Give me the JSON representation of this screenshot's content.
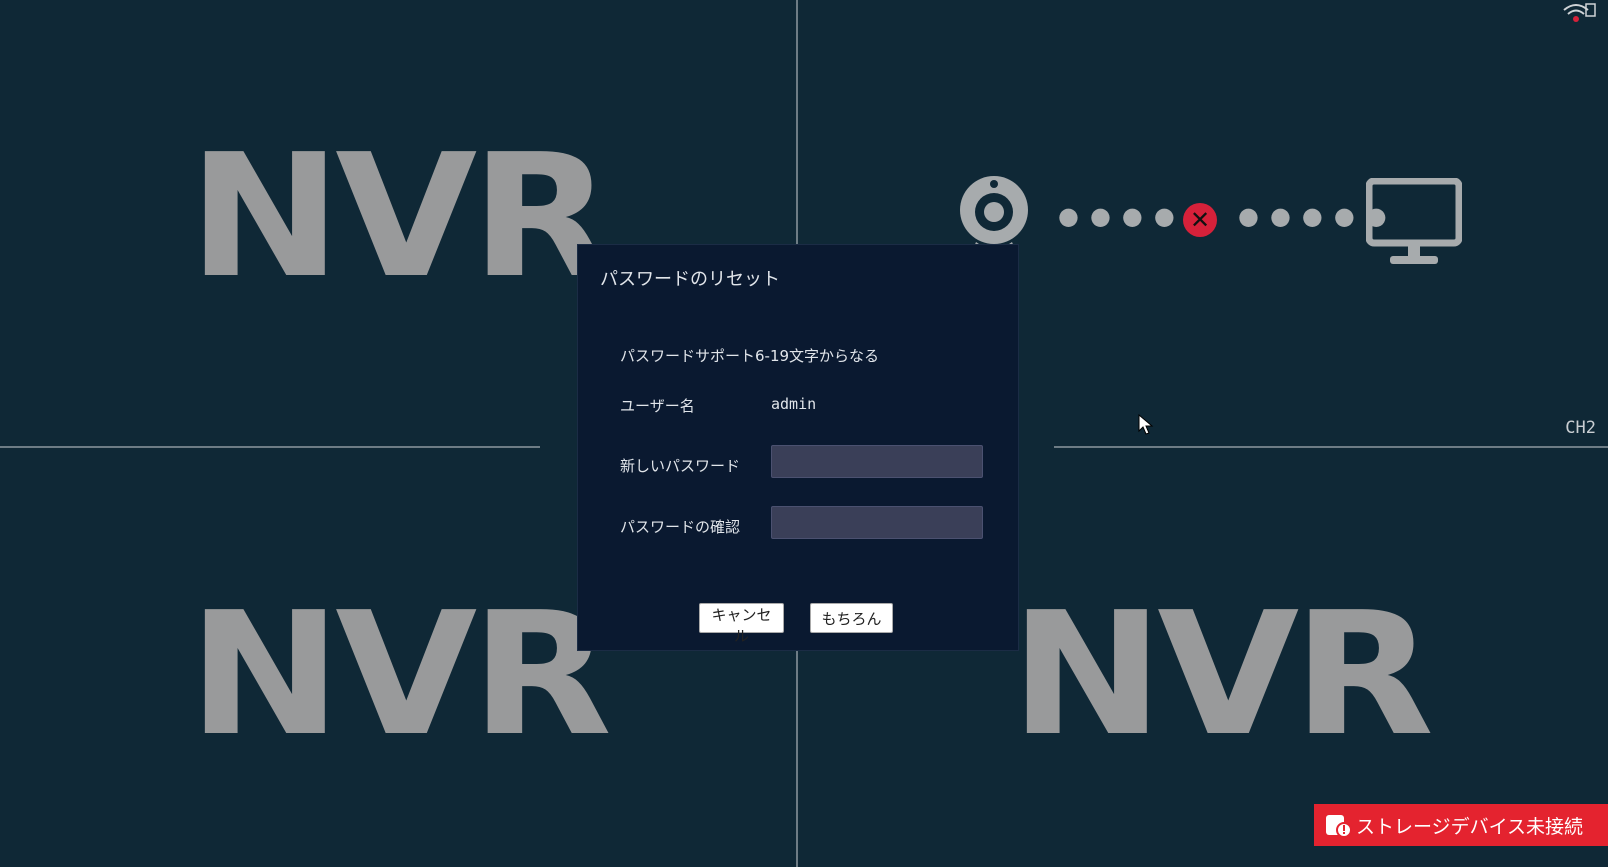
{
  "dialog": {
    "title": "パスワードのリセット",
    "hint": "パスワードサポート6-19文字からなる",
    "username_label": "ユーザー名",
    "username_value": "admin",
    "new_password_label": "新しいパスワード",
    "new_password_value": "",
    "confirm_password_label": "パスワードの確認",
    "confirm_password_value": "",
    "cancel_label": "キャンセル",
    "ok_label": "もちろん"
  },
  "channels": {
    "logo_text": "NVR",
    "ch2_label": "CH2"
  },
  "status": {
    "storage_text": "ストレージデバイス未接続",
    "storage_color": "#e4232f",
    "error_color": "#d6213a"
  },
  "icons": {
    "camera": "camera-icon",
    "disconnect": "disconnect-icon",
    "monitor": "monitor-icon",
    "wifi": "wifi-icon",
    "cursor": "cursor-icon",
    "storage": "storage-warning-icon"
  }
}
